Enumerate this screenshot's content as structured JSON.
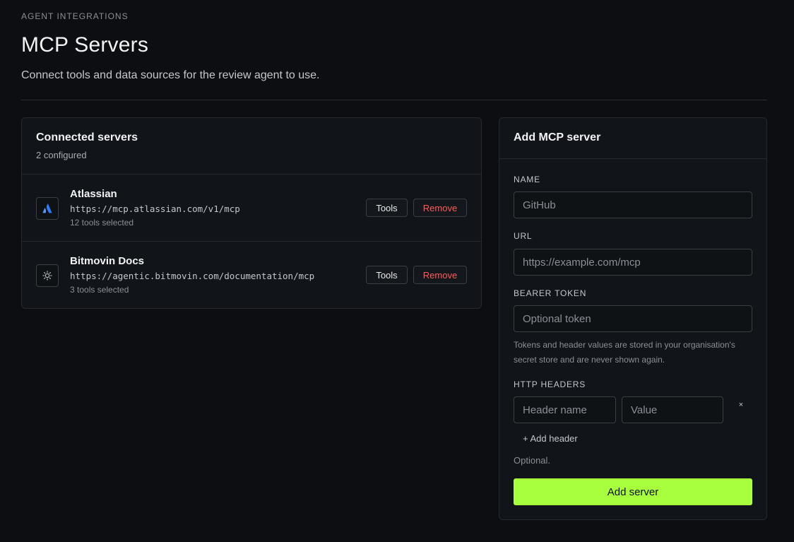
{
  "header": {
    "eyebrow": "AGENT INTEGRATIONS",
    "title": "MCP Servers",
    "subtitle": "Connect tools and data sources for the review agent to use."
  },
  "servers_card": {
    "title": "Connected servers",
    "count": "2 configured",
    "servers": [
      {
        "name": "Atlassian",
        "url": "https://mcp.atlassian.com/v1/mcp",
        "tools": "12 tools selected",
        "icon": "atlassian-icon",
        "icon_color": "#2f7df6",
        "tools_label": "Tools",
        "remove_label": "Remove"
      },
      {
        "name": "Bitmovin Docs",
        "url": "https://agentic.bitmovin.com/documentation/mcp",
        "tools": "3 tools selected",
        "icon": "bitmovin-icon",
        "icon_color": "#c4c8ce",
        "tools_label": "Tools",
        "remove_label": "Remove"
      }
    ]
  },
  "add_card": {
    "title": "Add MCP server",
    "name_label": "NAME",
    "name_placeholder": "GitHub",
    "url_label": "URL",
    "url_placeholder": "https://example.com/mcp",
    "token_label": "BEARER TOKEN",
    "token_placeholder": "Optional token",
    "hint": "Tokens and header values are stored in your organisation's secret store and are never shown again.",
    "headers_label": "HTTP HEADERS",
    "header_name_placeholder": "Header name",
    "header_value_placeholder": "Value",
    "remove_header": "×",
    "add_header": "+ Add header",
    "optional": "Optional.",
    "submit": "Add server"
  },
  "colors": {
    "background": "#0c0e11",
    "accent": "#a8ff3e",
    "danger": "#ff5c5c"
  }
}
